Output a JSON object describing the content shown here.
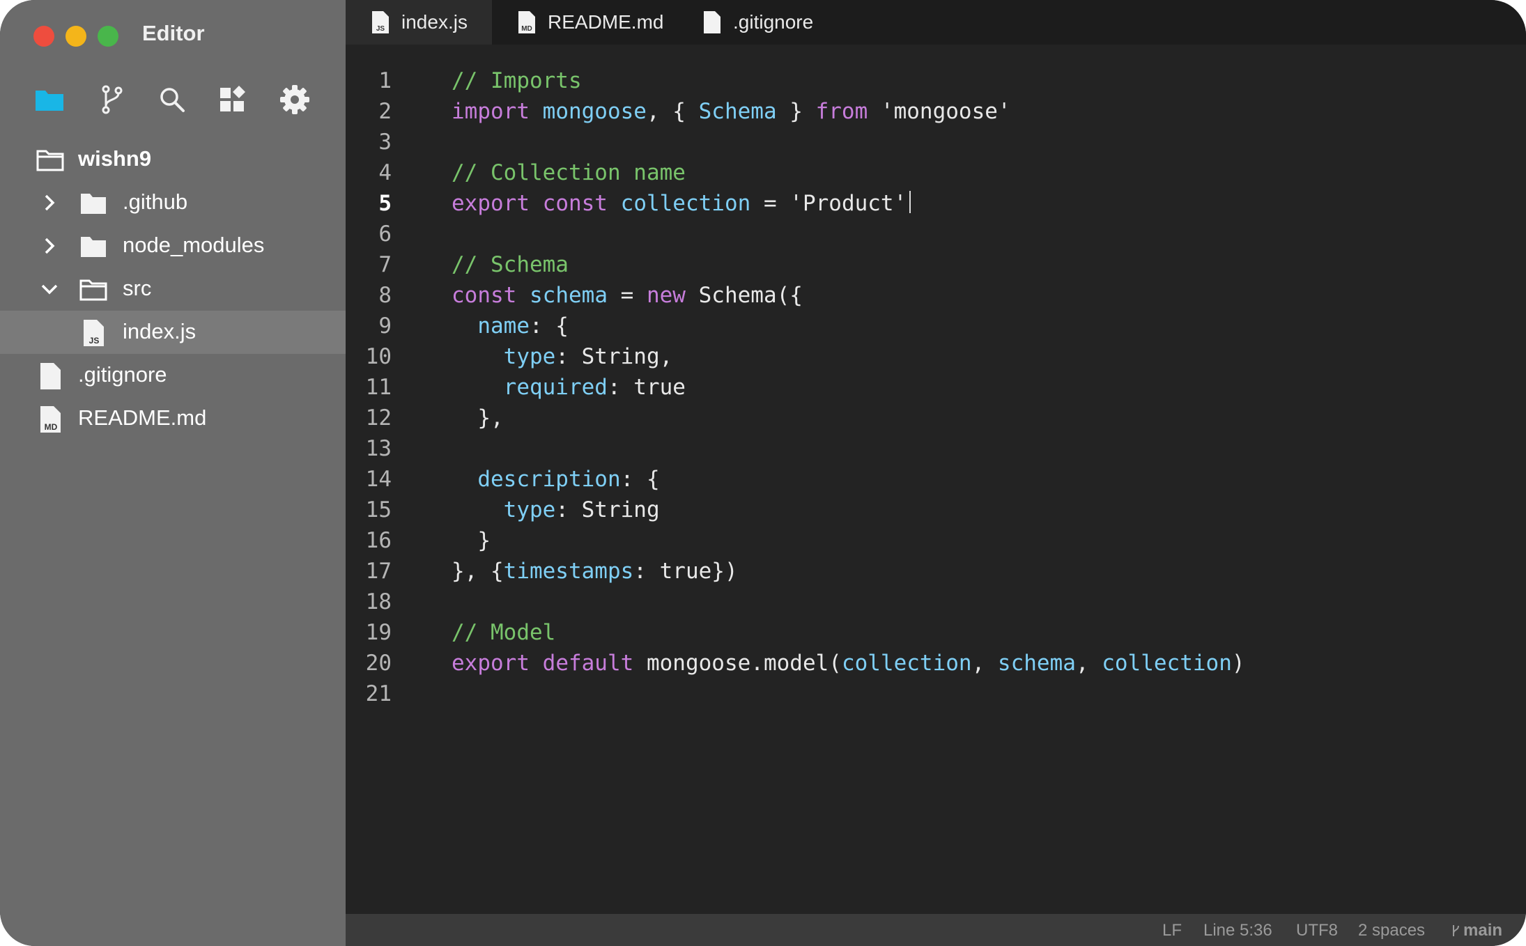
{
  "window": {
    "title": "Editor"
  },
  "colors": {
    "sidebar_bg": "#6b6b6b",
    "editor_bg": "#232323",
    "accent": "#19b6e6",
    "keyword": "#c77ddb",
    "comment": "#79c46b",
    "identifier": "#7fcff5"
  },
  "toolbar": {
    "items": [
      {
        "icon": "folder-icon",
        "active": true
      },
      {
        "icon": "git-branch-icon",
        "active": false
      },
      {
        "icon": "search-icon",
        "active": false
      },
      {
        "icon": "extensions-icon",
        "active": false
      },
      {
        "icon": "gear-icon",
        "active": false
      }
    ]
  },
  "explorer": {
    "root": "wishn9",
    "items": [
      {
        "label": ".github",
        "type": "folder",
        "expanded": false
      },
      {
        "label": "node_modules",
        "type": "folder",
        "expanded": false
      },
      {
        "label": "src",
        "type": "folder",
        "expanded": true
      },
      {
        "label": "index.js",
        "type": "js-file",
        "selected": true
      },
      {
        "label": ".gitignore",
        "type": "file"
      },
      {
        "label": "README.md",
        "type": "md-file"
      }
    ],
    "badges": {
      "js": "JS",
      "md": "MD"
    }
  },
  "tabs": [
    {
      "label": "index.js",
      "icon": "js-file-icon",
      "active": true
    },
    {
      "label": "README.md",
      "icon": "md-file-icon",
      "active": false
    },
    {
      "label": ".gitignore",
      "icon": "file-icon",
      "active": false
    }
  ],
  "editor": {
    "current_line": 5,
    "lines": [
      {
        "n": "1",
        "t": [
          [
            "cm",
            "// Imports"
          ]
        ]
      },
      {
        "n": "2",
        "t": [
          [
            "kw",
            "import"
          ],
          [
            "",
            " "
          ],
          [
            "id",
            "mongoose"
          ],
          [
            "",
            ", { "
          ],
          [
            "id",
            "Schema"
          ],
          [
            "",
            " } "
          ],
          [
            "kw",
            "from"
          ],
          [
            "",
            " 'mongoose'"
          ]
        ]
      },
      {
        "n": "3",
        "t": []
      },
      {
        "n": "4",
        "t": [
          [
            "cm",
            "// Collection name"
          ]
        ]
      },
      {
        "n": "5",
        "t": [
          [
            "kw",
            "export"
          ],
          [
            "",
            " "
          ],
          [
            "kw",
            "const"
          ],
          [
            "",
            " "
          ],
          [
            "id",
            "collection"
          ],
          [
            "",
            " = 'Product'"
          ]
        ]
      },
      {
        "n": "6",
        "t": []
      },
      {
        "n": "7",
        "t": [
          [
            "cm",
            "// Schema"
          ]
        ]
      },
      {
        "n": "8",
        "t": [
          [
            "kw",
            "const"
          ],
          [
            "",
            " "
          ],
          [
            "id",
            "schema"
          ],
          [
            "",
            " = "
          ],
          [
            "kw",
            "new"
          ],
          [
            "",
            " Schema({"
          ]
        ]
      },
      {
        "n": "9",
        "t": [
          [
            "",
            "  "
          ],
          [
            "id",
            "name"
          ],
          [
            "",
            ": {"
          ]
        ]
      },
      {
        "n": "10",
        "t": [
          [
            "",
            "    "
          ],
          [
            "id",
            "type"
          ],
          [
            "",
            ": String,"
          ]
        ]
      },
      {
        "n": "11",
        "t": [
          [
            "",
            "    "
          ],
          [
            "id",
            "required"
          ],
          [
            "",
            ": true"
          ]
        ]
      },
      {
        "n": "12",
        "t": [
          [
            "",
            "  },"
          ]
        ]
      },
      {
        "n": "13",
        "t": []
      },
      {
        "n": "14",
        "t": [
          [
            "",
            "  "
          ],
          [
            "id",
            "description"
          ],
          [
            "",
            ": {"
          ]
        ]
      },
      {
        "n": "15",
        "t": [
          [
            "",
            "    "
          ],
          [
            "id",
            "type"
          ],
          [
            "",
            ": String"
          ]
        ]
      },
      {
        "n": "16",
        "t": [
          [
            "",
            "  }"
          ]
        ]
      },
      {
        "n": "17",
        "t": [
          [
            "",
            "}, {"
          ],
          [
            "id",
            "timestamps"
          ],
          [
            "",
            ": true})"
          ]
        ]
      },
      {
        "n": "18",
        "t": []
      },
      {
        "n": "19",
        "t": [
          [
            "cm",
            "// Model"
          ]
        ]
      },
      {
        "n": "20",
        "t": [
          [
            "kw",
            "export"
          ],
          [
            "",
            " "
          ],
          [
            "kw",
            "default"
          ],
          [
            "",
            " mongoose.model("
          ],
          [
            "id",
            "collection"
          ],
          [
            "",
            ", "
          ],
          [
            "id",
            "schema"
          ],
          [
            "",
            ", "
          ],
          [
            "id",
            "collection"
          ],
          [
            "",
            ")"
          ]
        ]
      },
      {
        "n": "21",
        "t": []
      }
    ]
  },
  "status": {
    "eol": "LF",
    "cursor": "Line 5:36",
    "encoding": "UTF8",
    "indent": "2 spaces",
    "branch": "main"
  }
}
